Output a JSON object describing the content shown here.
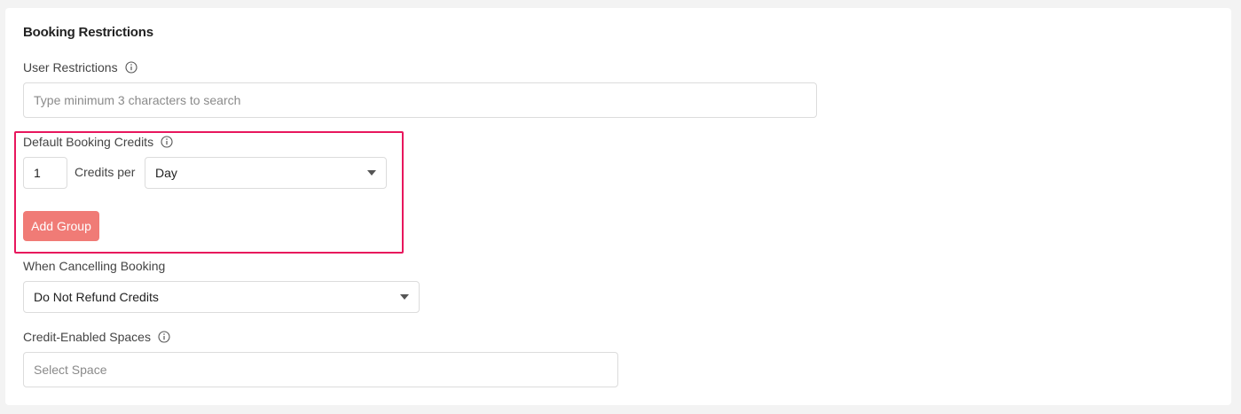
{
  "section": {
    "title": "Booking Restrictions"
  },
  "user_restrictions": {
    "label": "User Restrictions",
    "placeholder": "Type minimum 3 characters to search"
  },
  "default_booking_credits": {
    "label": "Default Booking Credits",
    "credits_value": "1",
    "credits_per_label": "Credits per",
    "period_selected": "Day",
    "add_group_label": "Add Group"
  },
  "cancelling": {
    "label": "When Cancelling Booking",
    "selected": "Do Not Refund Credits"
  },
  "spaces": {
    "label": "Credit-Enabled Spaces",
    "placeholder": "Select Space"
  },
  "colors": {
    "highlight_border": "#e8175d",
    "add_group_button": "#f07b76"
  }
}
